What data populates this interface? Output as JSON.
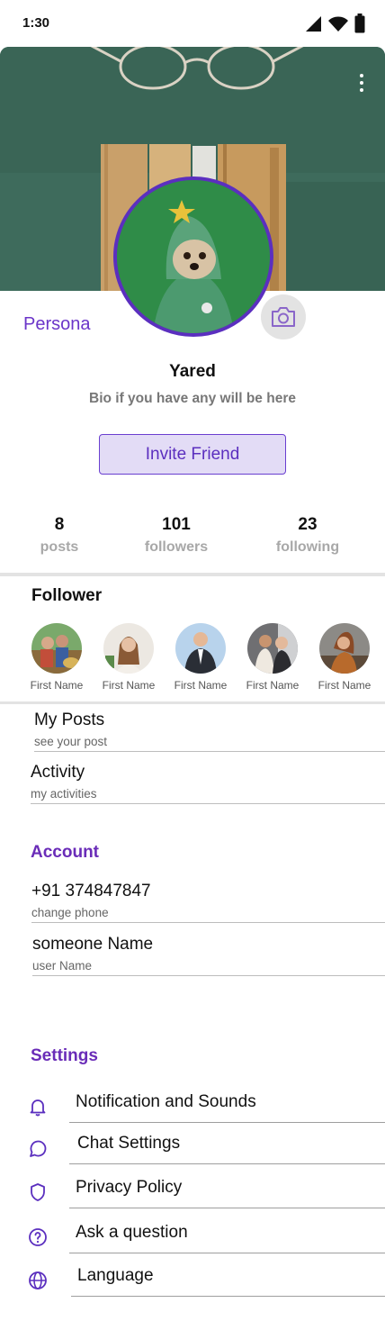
{
  "status_bar": {
    "time": "1:30"
  },
  "profile": {
    "brand": "Persona",
    "name": "Yared",
    "bio": "Bio if you have any will be here",
    "invite_label": "Invite Friend"
  },
  "stats": [
    {
      "value": "8",
      "label": "posts"
    },
    {
      "value": "101",
      "label": "followers"
    },
    {
      "value": "23",
      "label": "following"
    }
  ],
  "followers_section": {
    "title": "Follower",
    "items": [
      {
        "name": "First Name"
      },
      {
        "name": "First Name"
      },
      {
        "name": "First Name"
      },
      {
        "name": "First Name"
      },
      {
        "name": "First Name"
      }
    ]
  },
  "menu": [
    {
      "title": "My Posts",
      "subtitle": "see your post"
    },
    {
      "title": "Activity",
      "subtitle": "my activities"
    }
  ],
  "account": {
    "title": "Account",
    "items": [
      {
        "title": "+91 374847847",
        "subtitle": "change phone"
      },
      {
        "title": "someone Name",
        "subtitle": "user Name"
      }
    ]
  },
  "settings": {
    "title": "Settings",
    "items": [
      {
        "label": "Notification and Sounds",
        "icon": "bell-icon"
      },
      {
        "label": "Chat Settings",
        "icon": "chat-bubble-icon"
      },
      {
        "label": "Privacy Policy",
        "icon": "shield-icon"
      },
      {
        "label": "Ask a question",
        "icon": "question-circle-icon"
      },
      {
        "label": "Language",
        "icon": "globe-icon"
      }
    ]
  },
  "colors": {
    "accent": "#6a2cb8",
    "avatar_ring": "#5b2fbf",
    "invite_bg": "#e3dcf6"
  }
}
